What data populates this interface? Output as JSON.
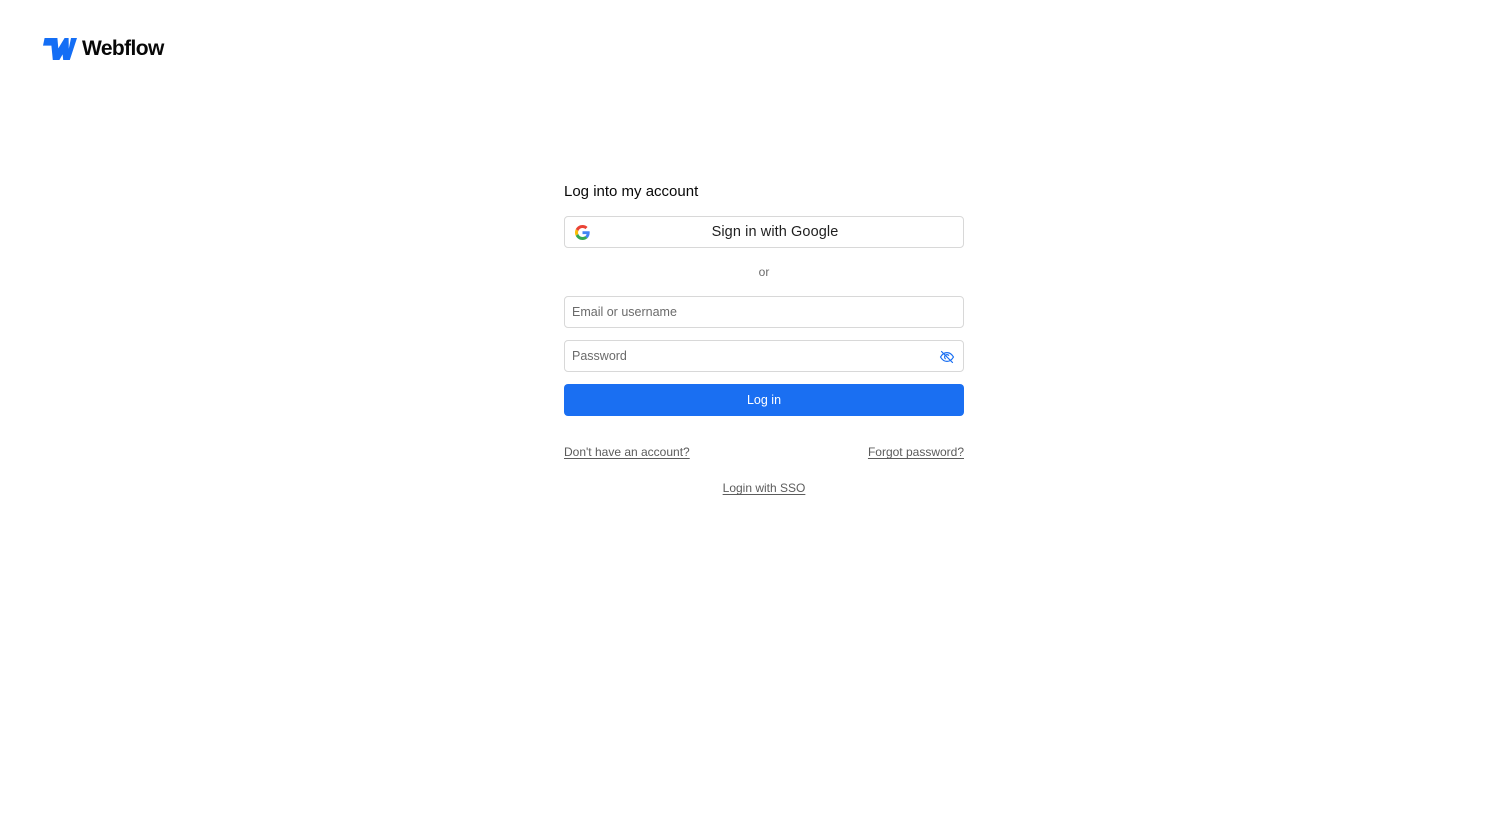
{
  "brand": {
    "name": "Webflow",
    "logo_icon": "webflow-logo-icon",
    "color": "#146ef5"
  },
  "login": {
    "title": "Log into my account",
    "google_button_label": "Sign in with Google",
    "google_icon": "google-icon",
    "divider_text": "or",
    "email_placeholder": "Email or username",
    "email_value": "",
    "password_placeholder": "Password",
    "password_value": "",
    "password_toggle_icon": "eye-off-icon",
    "submit_label": "Log in",
    "submit_color": "#1a6ff2"
  },
  "links": {
    "signup": "Don't have an account?",
    "forgot": "Forgot password?",
    "sso": "Login with SSO"
  }
}
